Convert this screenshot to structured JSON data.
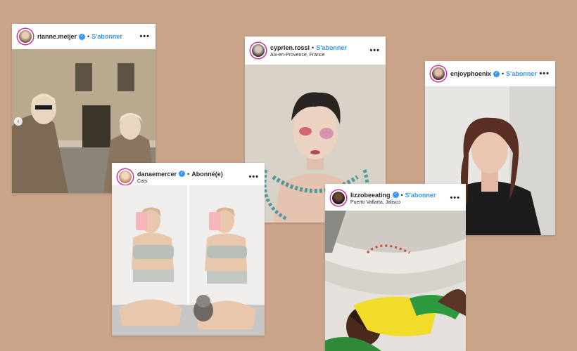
{
  "posts": [
    {
      "username": "rianne.meijer",
      "follow_label": "S'abonner",
      "location": ""
    },
    {
      "username": "cyprien.rossi",
      "follow_label": "S'abonner",
      "location": "Aix-en-Provence, France"
    },
    {
      "username": "enjoyphoenix",
      "follow_label": "S'abonner",
      "location": ""
    },
    {
      "username": "danaemercer",
      "follow_label": "Abonné(e)",
      "location": "Cats"
    },
    {
      "username": "lizzobeeating",
      "follow_label": "S'abonner",
      "location": "Puerto Vallarta, Jalisco"
    }
  ],
  "ui": {
    "separator": "•",
    "more_glyph": "•••",
    "verified_glyph": "✓",
    "prev_glyph": "‹"
  },
  "colors": {
    "background": "#c9a489",
    "link_blue": "#3897f0",
    "text_dark": "#262626"
  }
}
